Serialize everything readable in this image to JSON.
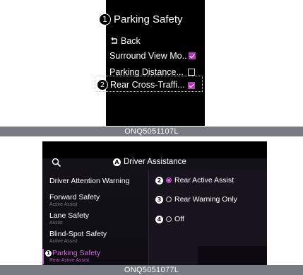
{
  "top": {
    "marker": "1",
    "title": "Parking Safety",
    "back_label": "Back",
    "items": [
      {
        "label": "Surround View Mo..",
        "checked": true
      },
      {
        "label": "Parking Distance...",
        "checked": false
      },
      {
        "label": "Rear Cross-Traffi...",
        "checked": true,
        "marker": "2"
      }
    ],
    "caption": "ONQ5051107L"
  },
  "bottom": {
    "title_marker": "A",
    "title": "Driver Assistance",
    "left_items": [
      {
        "label": "Driver Attention Warning",
        "sub": ""
      },
      {
        "label": "Forward Safety",
        "sub": "Active Assist"
      },
      {
        "label": "Lane Safety",
        "sub": "Assist"
      },
      {
        "label": "Blind-Spot Safety",
        "sub": "Active Assist"
      },
      {
        "label": "Parking Safety",
        "sub": "Rear Active Assist",
        "marker": "1",
        "selected": true
      }
    ],
    "options": [
      {
        "marker": "2",
        "label": "Rear Active Assist",
        "selected": true
      },
      {
        "marker": "3",
        "label": "Rear Warning Only",
        "selected": false
      },
      {
        "marker": "4",
        "label": "Off",
        "selected": false
      }
    ],
    "caption": "ONQ5051077L"
  },
  "colors": {
    "accent": "#b13cb3",
    "caption_bar": "#777b81",
    "screen_bg": "#000000"
  },
  "icons": [
    "back-arrow-icon",
    "checkbox-checked-icon",
    "checkbox-unchecked-icon",
    "search-icon",
    "radio-button-icon"
  ]
}
